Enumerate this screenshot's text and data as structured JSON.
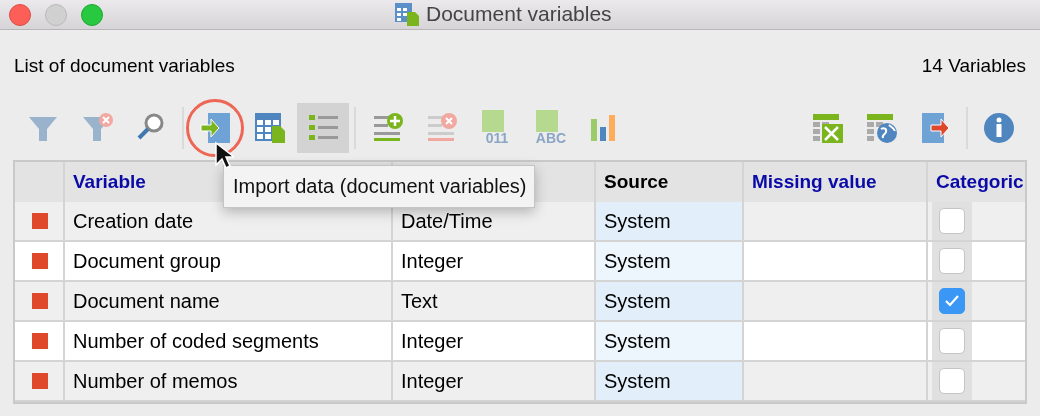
{
  "window": {
    "title": "Document variables"
  },
  "heading": "List of document variables",
  "count": "14 Variables",
  "toolbar": [
    {
      "kind": "button",
      "selected": false
    },
    {
      "kind": "button",
      "selected": false
    },
    {
      "kind": "button",
      "selected": false
    },
    {
      "kind": "separator"
    },
    {
      "kind": "button",
      "selected": false,
      "circled": true
    },
    {
      "kind": "button",
      "selected": false
    },
    {
      "kind": "button",
      "selected": true
    },
    {
      "kind": "separator"
    },
    {
      "kind": "button",
      "selected": false
    },
    {
      "kind": "button",
      "selected": false
    },
    {
      "kind": "button",
      "selected": false,
      "icon_text": "011"
    },
    {
      "kind": "button",
      "selected": false,
      "icon_text": "ABC"
    },
    {
      "kind": "button",
      "selected": false
    },
    {
      "kind": "spacer"
    },
    {
      "kind": "button",
      "selected": false
    },
    {
      "kind": "button",
      "selected": false
    },
    {
      "kind": "button",
      "selected": false
    },
    {
      "kind": "separator"
    },
    {
      "kind": "button",
      "selected": false
    }
  ],
  "table": {
    "columns": [
      {
        "kind": "marker"
      },
      {
        "kind": "text",
        "label": "Variable",
        "color": "#0a0aa8"
      },
      {
        "kind": "text"
      },
      {
        "kind": "source",
        "label": "Source",
        "color": "#000000"
      },
      {
        "kind": "text",
        "label": "Missing value",
        "color": "#0a0aa8"
      },
      {
        "kind": "check",
        "label": "Categoric",
        "color": "#0a0aa8"
      }
    ],
    "rows": [
      {
        "color": "#e0482b",
        "variable": "Creation date",
        "type": "Date/Time",
        "source": "System",
        "categorical": false
      },
      {
        "color": "#e0482b",
        "variable": "Document group",
        "type": "Integer",
        "source": "System",
        "categorical": false
      },
      {
        "color": "#e0482b",
        "variable": "Document name",
        "type": "Text",
        "source": "System",
        "categorical": true
      },
      {
        "color": "#e0482b",
        "variable": "Number of coded segments",
        "type": "Integer",
        "source": "System",
        "categorical": false
      },
      {
        "color": "#e0482b",
        "variable": "Number of memos",
        "type": "Integer",
        "source": "System",
        "categorical": false
      }
    ]
  },
  "tooltip": "Import data (document variables)"
}
